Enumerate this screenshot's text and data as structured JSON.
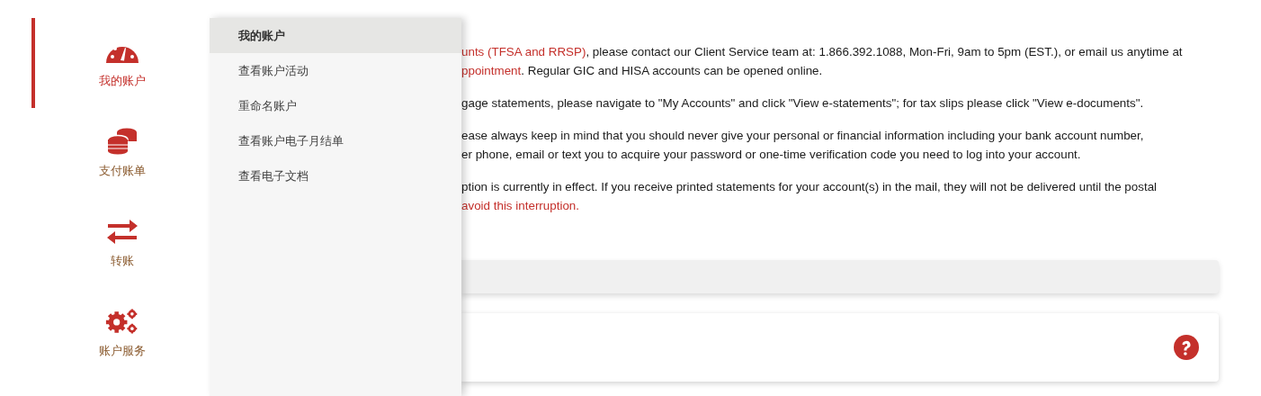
{
  "sidebar": {
    "items": [
      {
        "label": "我的账户",
        "kind": "gauge",
        "selected": true
      },
      {
        "label": "支付账单",
        "kind": "coins",
        "selected": false
      },
      {
        "label": "转账",
        "kind": "transfer",
        "selected": false
      },
      {
        "label": "账户服务",
        "kind": "gears",
        "selected": false
      }
    ]
  },
  "submenu": {
    "items": [
      {
        "label": "我的账户",
        "selected": true
      },
      {
        "label": "查看账户活动",
        "selected": false
      },
      {
        "label": "重命名账户",
        "selected": false
      },
      {
        "label": "查看账户电子月结单",
        "selected": false
      },
      {
        "label": "查看电子文档",
        "selected": false
      }
    ]
  },
  "content": {
    "paragraphs": [
      {
        "lines": [
          [
            {
              "text": "unts (TFSA and RRSP)",
              "link": true
            },
            {
              "text": ", please contact our Client Service team at: 1.866.392.1088, Mon-Fri, 9am to 5pm (EST.), or email us anytime at",
              "link": false
            }
          ],
          [
            {
              "text": "ppointment",
              "link": true
            },
            {
              "text": ". Regular GIC and HISA accounts can be opened online.",
              "link": false
            }
          ]
        ]
      },
      {
        "lines": [
          [
            {
              "text": "gage statements, please navigate to \"My Accounts\" and click \"View e-statements\"; for tax slips please click \"View e-documents\".",
              "link": false
            }
          ]
        ]
      },
      {
        "lines": [
          [
            {
              "text": "ease always keep in mind that you should never give your personal or financial information including your bank account number,",
              "link": false
            }
          ],
          [
            {
              "text": "er phone, email or text you to acquire your password or one-time verification code you need to log into your account.",
              "link": false
            }
          ]
        ]
      },
      {
        "lines": [
          [
            {
              "text": "ption is currently in effect. If you receive printed statements for your account(s) in the mail, they will not be delivered until the postal",
              "link": false
            }
          ],
          [
            {
              "text": "avoid this interruption.",
              "link": true
            }
          ]
        ]
      }
    ]
  }
}
